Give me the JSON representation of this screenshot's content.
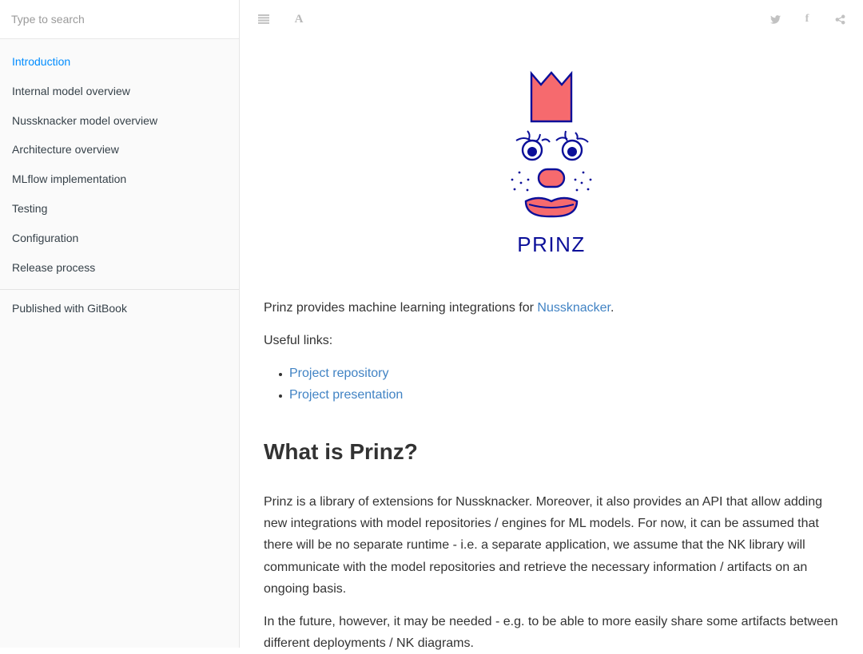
{
  "search": {
    "placeholder": "Type to search"
  },
  "sidebar": {
    "items": [
      {
        "label": "Introduction",
        "active": true
      },
      {
        "label": "Internal model overview"
      },
      {
        "label": "Nussknacker model overview"
      },
      {
        "label": "Architecture overview"
      },
      {
        "label": "MLflow implementation"
      },
      {
        "label": "Testing"
      },
      {
        "label": "Configuration"
      },
      {
        "label": "Release process"
      }
    ],
    "published": "Published with GitBook"
  },
  "header": {
    "icons": [
      "toggle-sidebar-icon",
      "font-settings-icon",
      "twitter-icon",
      "facebook-icon",
      "share-icon"
    ],
    "font_glyph": "A",
    "facebook_glyph": "f"
  },
  "logo": {
    "text": "PRINZ",
    "colors": {
      "navy": "#0b0f99",
      "coral": "#f66a6e"
    }
  },
  "content": {
    "intro_prefix": "Prinz provides machine learning integrations for ",
    "intro_link": "Nussknacker",
    "intro_suffix": ".",
    "useful_links": "Useful links:",
    "links": [
      "Project repository",
      "Project presentation"
    ],
    "heading": "What is Prinz?",
    "para1": "Prinz is a library of extensions for Nussknacker. Moreover, it also provides an API that allow adding new integrations with model repositories / engines for ML models. For now, it can be assumed that there will be no separate runtime - i.e. a separate application, we assume that the NK library will communicate with the model repositories and retrieve the necessary information / artifacts on an ongoing basis.",
    "para2": "In the future, however, it may be needed - e.g. to be able to more easily share some artifacts between different deployments / NK diagrams."
  },
  "colors": {
    "accent": "#008cff",
    "link": "#4183c4",
    "text": "#333333",
    "sidebar_bg": "#fafafa"
  }
}
